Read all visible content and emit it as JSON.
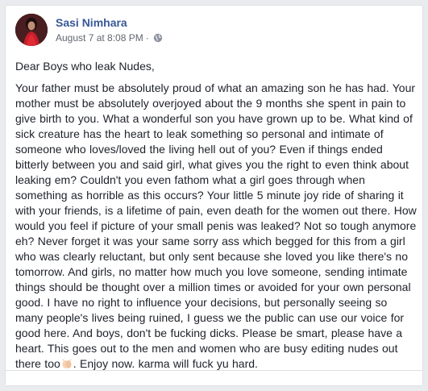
{
  "post": {
    "author": "Sasi Nimhara",
    "timestamp": "August 7 at 8:08 PM",
    "separator": "·",
    "privacy_icon": "globe-icon",
    "greeting": "Dear Boys who leak Nudes,",
    "body_part1": "Your father must be absolutely proud of what an amazing son he has had. Your mother must be absolutely overjoyed about the 9 months she spent in pain to give birth to you. What a wonderful son you have grown up to be. What kind of sick creature has the heart to leak something so personal and intimate of someone who loves/loved the living hell out of you? Even if things ended bitterly between you and said girl, what gives you the right to even think about leaking em? Couldn't you even fathom what a girl goes through when something as horrible as this occurs? Your little 5 minute joy ride of sharing it with your friends, is a lifetime of pain, even death for the women out there. How would you feel if picture of your small penis was leaked? Not so tough anymore eh? Never forget it was your same sorry ass which begged for this from a girl who was clearly reluctant, but only sent because she loved you like there's no tomorrow. And girls, no matter how much you love someone, sending intimate things should be thought over a million times or avoided for your own personal good. I have no right to influence your decisions, but personally seeing so many people's lives being ruined, I guess we the public can use our voice for good here. And boys, don't be fucking dicks. Please be smart, please have a heart. This goes out to the men and women who are busy editing nudes out there too",
    "emoji_icon": "clapping-hands-emoji",
    "body_part2": ". Enjoy now. karma will fuck yu hard."
  },
  "colors": {
    "author_link": "#385898",
    "meta_text": "#616770",
    "body_text": "#1d2129",
    "background": "#e9ebee"
  }
}
